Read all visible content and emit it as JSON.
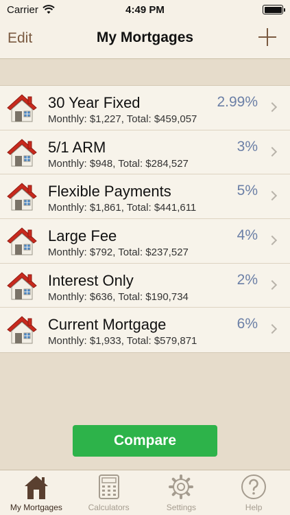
{
  "status_bar": {
    "carrier": "Carrier",
    "time": "4:49 PM"
  },
  "nav": {
    "edit_label": "Edit",
    "title": "My Mortgages",
    "add_icon": "plus-icon"
  },
  "mortgages": [
    {
      "name": "30 Year Fixed",
      "rate": "2.99%",
      "detail": "Monthly: $1,227, Total: $459,057"
    },
    {
      "name": "5/1 ARM",
      "rate": "3%",
      "detail": "Monthly: $948, Total: $284,527"
    },
    {
      "name": "Flexible Payments",
      "rate": "5%",
      "detail": "Monthly: $1,861, Total: $441,611"
    },
    {
      "name": "Large Fee",
      "rate": "4%",
      "detail": "Monthly: $792, Total: $237,527"
    },
    {
      "name": "Interest Only",
      "rate": "2%",
      "detail": "Monthly: $636, Total: $190,734"
    },
    {
      "name": "Current Mortgage",
      "rate": "6%",
      "detail": "Monthly: $1,933, Total: $579,871"
    }
  ],
  "compare_label": "Compare",
  "tabs": [
    {
      "label": "My Mortgages",
      "icon": "house-icon",
      "active": true
    },
    {
      "label": "Calculators",
      "icon": "calculator-icon",
      "active": false
    },
    {
      "label": "Settings",
      "icon": "gear-icon",
      "active": false
    },
    {
      "label": "Help",
      "icon": "question-icon",
      "active": false
    }
  ],
  "colors": {
    "accent_brown": "#7a5a40",
    "rate_blue": "#6b7fa6",
    "compare_green": "#2db34a"
  }
}
